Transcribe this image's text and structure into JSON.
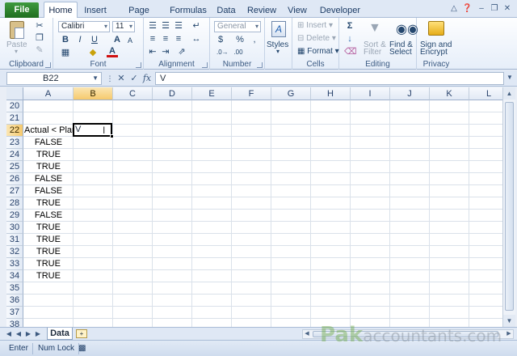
{
  "tabs": {
    "file": "File",
    "items": [
      "Home",
      "Insert",
      "Page Layout",
      "Formulas",
      "Data",
      "Review",
      "View",
      "Developer"
    ],
    "active": "Home"
  },
  "ribbon": {
    "clipboard": {
      "label": "Clipboard",
      "paste": "Paste"
    },
    "font": {
      "label": "Font",
      "name": "Calibri",
      "size": "11",
      "bold": "B",
      "italic": "I",
      "underline": "U",
      "grow": "A",
      "shrink": "A",
      "font_color": "A"
    },
    "alignment": {
      "label": "Alignment"
    },
    "number": {
      "label": "Number",
      "format": "General",
      "currency": "$",
      "percent": "%",
      "comma": ","
    },
    "styles": {
      "label": "Styles"
    },
    "cells": {
      "label": "Cells",
      "insert": "Insert",
      "delete": "Delete",
      "format": "Format"
    },
    "editing": {
      "label": "Editing",
      "sigma": "Σ",
      "sort": "Sort &",
      "filter": "Filter",
      "find": "Find &",
      "select": "Select"
    },
    "privacy": {
      "label": "Privacy",
      "sign": "Sign and",
      "encrypt": "Encrypt"
    }
  },
  "formula_bar": {
    "name_box": "B22",
    "content": "V",
    "fx": "fx"
  },
  "grid": {
    "columns": [
      "A",
      "B",
      "C",
      "D",
      "E",
      "F",
      "G",
      "H",
      "I",
      "J",
      "K",
      "L"
    ],
    "selected_column": "B",
    "rows": [
      {
        "num": "20",
        "a": ""
      },
      {
        "num": "21",
        "a": ""
      },
      {
        "num": "22",
        "a": "Actual < Plan"
      },
      {
        "num": "23",
        "a": "FALSE"
      },
      {
        "num": "24",
        "a": "TRUE"
      },
      {
        "num": "25",
        "a": "TRUE"
      },
      {
        "num": "26",
        "a": "FALSE"
      },
      {
        "num": "27",
        "a": "FALSE"
      },
      {
        "num": "28",
        "a": "TRUE"
      },
      {
        "num": "29",
        "a": "FALSE"
      },
      {
        "num": "30",
        "a": "TRUE"
      },
      {
        "num": "31",
        "a": "TRUE"
      },
      {
        "num": "32",
        "a": "TRUE"
      },
      {
        "num": "33",
        "a": "TRUE"
      },
      {
        "num": "34",
        "a": "TRUE"
      },
      {
        "num": "35",
        "a": ""
      },
      {
        "num": "36",
        "a": ""
      },
      {
        "num": "37",
        "a": ""
      },
      {
        "num": "38",
        "a": ""
      }
    ],
    "selected_row": "22",
    "active_cell_value": "V"
  },
  "sheet": {
    "tab": "Data"
  },
  "status": {
    "mode": "Enter",
    "num_lock": "Num Lock"
  },
  "watermark": {
    "brand": "Pak",
    "rest": "accountants.com"
  },
  "colors": {
    "accent": "#f6c96d",
    "file_tab": "#2a7d2a"
  }
}
